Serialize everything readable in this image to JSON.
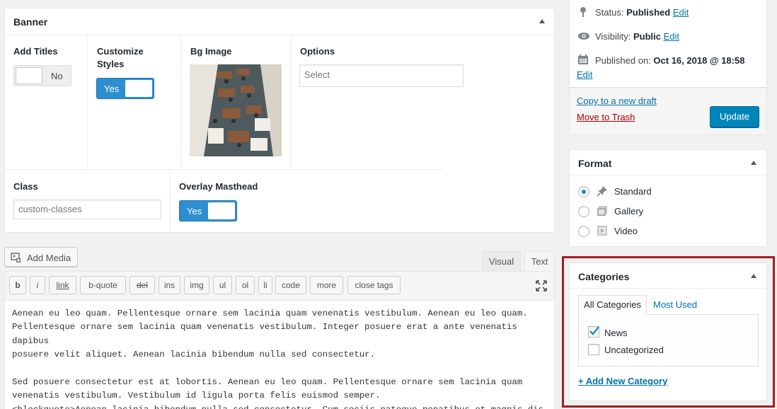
{
  "banner": {
    "title": "Banner",
    "fields": {
      "add_titles": {
        "label": "Add Titles",
        "toggle_text": "No"
      },
      "customize_styles": {
        "label": "Customize Styles",
        "toggle_text": "Yes"
      },
      "bg_image": {
        "label": "Bg Image"
      },
      "options": {
        "label": "Options",
        "placeholder": "Select"
      },
      "class": {
        "label": "Class",
        "value": "custom-classes"
      },
      "overlay_masthead": {
        "label": "Overlay Masthead",
        "toggle_text": "Yes"
      }
    }
  },
  "editor": {
    "add_media_label": "Add Media",
    "tabs": [
      "Visual",
      "Text"
    ],
    "active_tab": "Text",
    "quicktags": [
      "b",
      "i",
      "link",
      "b-quote",
      "del",
      "ins",
      "img",
      "ul",
      "ol",
      "li",
      "code",
      "more",
      "close tags"
    ],
    "content": "Aenean eu leo quam. Pellentesque ornare sem lacinia quam venenatis vestibulum. Aenean eu leo quam.\nPellentesque ornare sem lacinia quam venenatis vestibulum. Integer posuere erat a ante venenatis dapibus\nposuere velit aliquet. Aenean lacinia bibendum nulla sed consectetur.\n\nSed posuere consectetur est at lobortis. Aenean eu leo quam. Pellentesque ornare sem lacinia quam\nvenenatis vestibulum. Vestibulum id ligula porta felis euismod semper.\n<blockquote>Aenean lacinia bibendum nulla sed consectetur. Cum sociis natoque penatibus et magnis dis\nparturient montes, nascetur ridiculus mus.</blockquote>"
  },
  "publish": {
    "status_label": "Status:",
    "status_value": "Published",
    "visibility_label": "Visibility:",
    "visibility_value": "Public",
    "published_label": "Published on:",
    "published_value": "Oct 16, 2018 @ 18:58",
    "edit_label": "Edit",
    "copy_draft": "Copy to a new draft",
    "move_trash": "Move to Trash",
    "update_label": "Update"
  },
  "format": {
    "title": "Format",
    "options": [
      {
        "label": "Standard",
        "icon": "pin-icon",
        "checked": true
      },
      {
        "label": "Gallery",
        "icon": "gallery-icon",
        "checked": false
      },
      {
        "label": "Video",
        "icon": "video-icon",
        "checked": false
      }
    ]
  },
  "categories": {
    "title": "Categories",
    "tabs": [
      "All Categories",
      "Most Used"
    ],
    "items": [
      {
        "label": "News",
        "checked": true
      },
      {
        "label": "Uncategorized",
        "checked": false
      }
    ],
    "add_new": "+ Add New Category"
  },
  "colors": {
    "link": "#0073aa",
    "trash": "#a00",
    "toggle_on": "#2e8fd0",
    "update_button": "#0085ba",
    "highlight_border": "#a51d1d"
  }
}
